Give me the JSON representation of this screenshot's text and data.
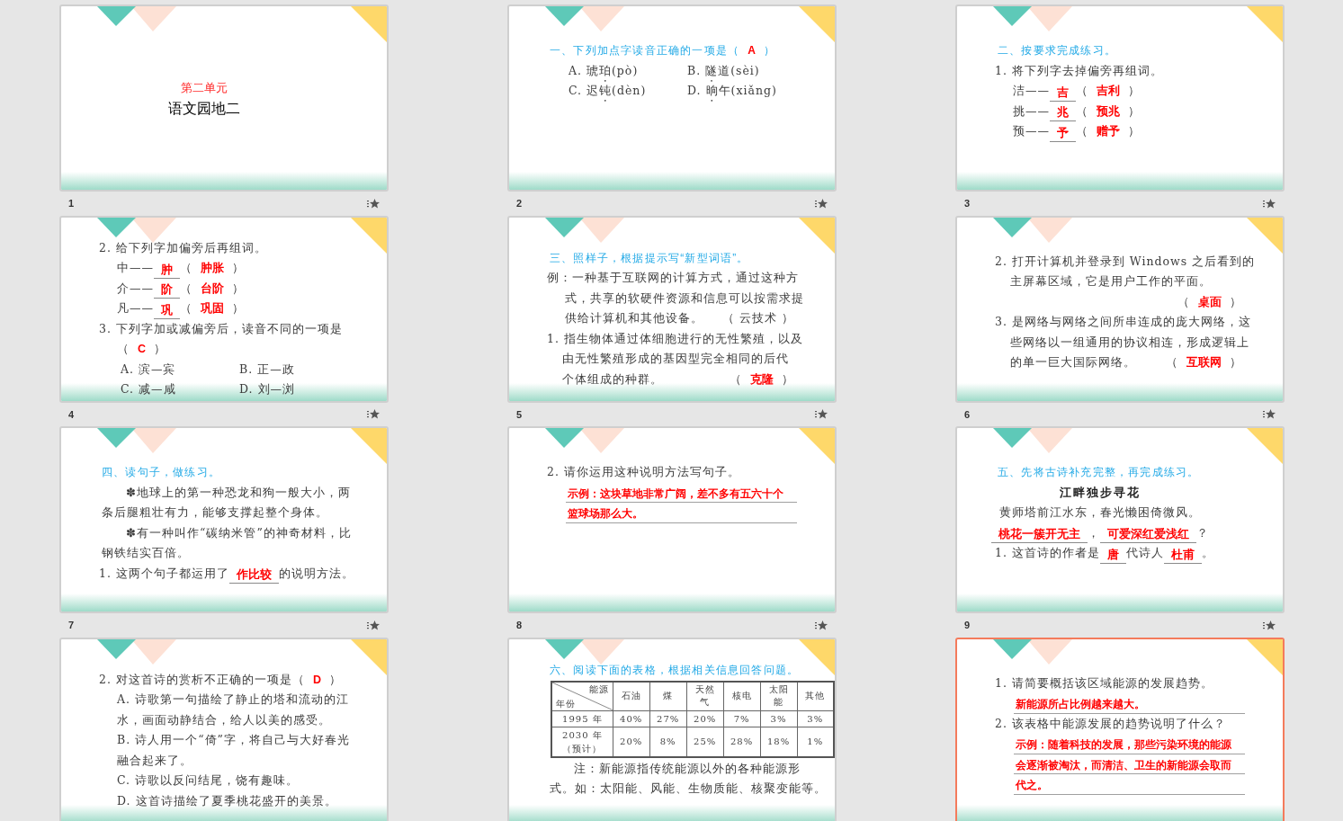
{
  "slides": [
    {
      "number": "1",
      "selected": false,
      "kind": "title",
      "lines": [
        {
          "kind": "kicker",
          "segs": [
            {
              "kind": "plain",
              "text": "第二单元"
            }
          ]
        },
        {
          "kind": "title",
          "segs": [
            {
              "kind": "plain",
              "text": "语文园地二"
            }
          ]
        }
      ]
    },
    {
      "number": "2",
      "selected": false,
      "kind": "content",
      "lines": [
        {
          "kind": "heading",
          "segs": [
            {
              "kind": "plain",
              "text": "一、下列加点字读音正确的一项是（"
            },
            {
              "kind": "answer",
              "text": "A"
            },
            {
              "kind": "plain",
              "text": "）"
            }
          ]
        },
        {
          "kind": "choices",
          "cols": [
            [
              {
                "kind": "dotted",
                "before": "A. 琥",
                "dotted": "珀",
                "after": "(pò)"
              }
            ],
            [
              {
                "kind": "dotted",
                "before": "B. ",
                "dotted": "隧",
                "after": "道(sèi)"
              }
            ]
          ]
        },
        {
          "kind": "choices",
          "cols": [
            [
              {
                "kind": "dotted",
                "before": "C. 迟",
                "dotted": "钝",
                "after": "(dèn)"
              }
            ],
            [
              {
                "kind": "dotted",
                "before": "D. ",
                "dotted": "晌",
                "after": "午(xiǎng)"
              }
            ]
          ]
        }
      ]
    },
    {
      "number": "3",
      "selected": false,
      "kind": "content",
      "lines": [
        {
          "kind": "heading",
          "segs": [
            {
              "kind": "plain",
              "text": "二、按要求完成练习。"
            }
          ]
        },
        {
          "kind": "item",
          "segs": [
            {
              "kind": "plain",
              "text": "1. 将下列字去掉偏旁再组词。"
            }
          ]
        },
        {
          "kind": "sub",
          "segs": [
            {
              "kind": "plain",
              "text": "洁——"
            },
            {
              "kind": "blank",
              "text": "吉"
            },
            {
              "kind": "plain",
              "text": "（"
            },
            {
              "kind": "answer",
              "text": "吉利"
            },
            {
              "kind": "plain",
              "text": "）"
            }
          ]
        },
        {
          "kind": "sub",
          "segs": [
            {
              "kind": "plain",
              "text": "挑——"
            },
            {
              "kind": "blank",
              "text": "兆"
            },
            {
              "kind": "plain",
              "text": "（"
            },
            {
              "kind": "answer",
              "text": "预兆"
            },
            {
              "kind": "plain",
              "text": "）"
            }
          ]
        },
        {
          "kind": "sub",
          "segs": [
            {
              "kind": "plain",
              "text": "预——"
            },
            {
              "kind": "blank",
              "text": "予"
            },
            {
              "kind": "plain",
              "text": "（"
            },
            {
              "kind": "answer",
              "text": "赠予"
            },
            {
              "kind": "plain",
              "text": "）"
            }
          ]
        }
      ]
    },
    {
      "number": "4",
      "selected": false,
      "kind": "content",
      "lines": [
        {
          "kind": "item",
          "segs": [
            {
              "kind": "plain",
              "text": "2. 给下列字加偏旁后再组词。"
            }
          ]
        },
        {
          "kind": "sub",
          "segs": [
            {
              "kind": "plain",
              "text": "中——"
            },
            {
              "kind": "blank",
              "text": "肿"
            },
            {
              "kind": "plain",
              "text": "（"
            },
            {
              "kind": "answer",
              "text": "肿胀"
            },
            {
              "kind": "plain",
              "text": "）"
            }
          ]
        },
        {
          "kind": "sub",
          "segs": [
            {
              "kind": "plain",
              "text": "介——"
            },
            {
              "kind": "blank",
              "text": "阶"
            },
            {
              "kind": "plain",
              "text": "（"
            },
            {
              "kind": "answer",
              "text": "台阶"
            },
            {
              "kind": "plain",
              "text": "）"
            }
          ]
        },
        {
          "kind": "sub",
          "segs": [
            {
              "kind": "plain",
              "text": "凡——"
            },
            {
              "kind": "blank",
              "text": "巩"
            },
            {
              "kind": "plain",
              "text": "（"
            },
            {
              "kind": "answer",
              "text": "巩固"
            },
            {
              "kind": "plain",
              "text": "）"
            }
          ]
        },
        {
          "kind": "item",
          "segs": [
            {
              "kind": "plain",
              "text": "3. 下列字加或减偏旁后，读音不同的一项是"
            }
          ]
        },
        {
          "kind": "sub",
          "segs": [
            {
              "kind": "plain",
              "text": "（"
            },
            {
              "kind": "answer",
              "text": "C"
            },
            {
              "kind": "plain",
              "text": "）"
            }
          ]
        },
        {
          "kind": "choices",
          "cols": [
            [
              {
                "kind": "plain",
                "text": "A. 滨—宾"
              }
            ],
            [
              {
                "kind": "plain",
                "text": "B. 正—政"
              }
            ]
          ]
        },
        {
          "kind": "choices",
          "cols": [
            [
              {
                "kind": "plain",
                "text": "C. 减—咸"
              }
            ],
            [
              {
                "kind": "plain",
                "text": "D. 刘—浏"
              }
            ]
          ]
        }
      ]
    },
    {
      "number": "5",
      "selected": false,
      "kind": "content",
      "lines": [
        {
          "kind": "heading",
          "segs": [
            {
              "kind": "plain",
              "text": "三、照样子，根据提示写“新型词语”。"
            }
          ]
        },
        {
          "kind": "item",
          "segs": [
            {
              "kind": "plain",
              "text": "例：一种基于互联网的计算方式，通过这种方"
            }
          ]
        },
        {
          "kind": "sub",
          "segs": [
            {
              "kind": "plain",
              "text": "式，共享的软硬件资源和信息可以按需求提"
            }
          ]
        },
        {
          "kind": "sub",
          "segs": [
            {
              "kind": "plain",
              "text": "供给计算机和其他设备。"
            },
            {
              "kind": "tail",
              "text": "（ 云技术 ）"
            }
          ]
        },
        {
          "kind": "item",
          "segs": [
            {
              "kind": "plain",
              "text": "1. 指生物体通过体细胞进行的无性繁殖，以及"
            }
          ]
        },
        {
          "kind": "cont",
          "segs": [
            {
              "kind": "plain",
              "text": "由无性繁殖形成的基因型完全相同的后代"
            }
          ]
        },
        {
          "kind": "cont",
          "segs": [
            {
              "kind": "plain",
              "text": "个体组成的种群。"
            },
            {
              "kind": "tail",
              "text": "（"
            },
            {
              "kind": "answer",
              "text": "克隆"
            },
            {
              "kind": "plain",
              "text": "）"
            }
          ]
        }
      ]
    },
    {
      "number": "6",
      "selected": false,
      "kind": "content",
      "lines": [
        {
          "kind": "item",
          "segs": [
            {
              "kind": "plain",
              "text": "2. 打开计算机并登录到 Windows 之后看到的"
            }
          ]
        },
        {
          "kind": "cont",
          "segs": [
            {
              "kind": "plain",
              "text": "主屏幕区域，它是用户工作的平面。"
            }
          ]
        },
        {
          "kind": "right",
          "segs": [
            {
              "kind": "plain",
              "text": "（"
            },
            {
              "kind": "answer",
              "text": "桌面"
            },
            {
              "kind": "plain",
              "text": "）"
            }
          ]
        },
        {
          "kind": "item",
          "segs": [
            {
              "kind": "plain",
              "text": "3. 是网络与网络之间所串连成的庞大网络，这"
            }
          ]
        },
        {
          "kind": "cont",
          "segs": [
            {
              "kind": "plain",
              "text": "些网络以一组通用的协议相连，形成逻辑上"
            }
          ]
        },
        {
          "kind": "cont",
          "segs": [
            {
              "kind": "plain",
              "text": "的单一巨大国际网络。"
            },
            {
              "kind": "tail",
              "text": "（"
            },
            {
              "kind": "answer",
              "text": "互联网"
            },
            {
              "kind": "plain",
              "text": "）"
            }
          ]
        }
      ]
    },
    {
      "number": "7",
      "selected": false,
      "kind": "content",
      "lines": [
        {
          "kind": "heading",
          "segs": [
            {
              "kind": "plain",
              "text": "四、读句子，做练习。"
            }
          ]
        },
        {
          "kind": "indent",
          "segs": [
            {
              "kind": "plain",
              "text": "✽地球上的第一种恐龙和狗一般大小，两"
            }
          ]
        },
        {
          "kind": "flush",
          "segs": [
            {
              "kind": "plain",
              "text": "条后腿粗壮有力，能够支撑起整个身体。"
            }
          ]
        },
        {
          "kind": "indent",
          "segs": [
            {
              "kind": "plain",
              "text": "✽有一种叫作“碳纳米管”的神奇材料，比"
            }
          ]
        },
        {
          "kind": "flush",
          "segs": [
            {
              "kind": "plain",
              "text": "钢铁结实百倍。"
            }
          ]
        },
        {
          "kind": "item",
          "segs": [
            {
              "kind": "plain",
              "text": "1. 这两个句子都运用了"
            },
            {
              "kind": "blank",
              "text": "作比较"
            },
            {
              "kind": "plain",
              "text": "的说明方法。"
            }
          ]
        }
      ]
    },
    {
      "number": "8",
      "selected": false,
      "kind": "content",
      "lines": [
        {
          "kind": "item",
          "segs": [
            {
              "kind": "plain",
              "text": "2. 请你运用这种说明方法写句子。"
            }
          ]
        },
        {
          "kind": "fill",
          "segs": [
            {
              "kind": "plain",
              "text": "示例：这块草地非常广阔，差不多有五六十个"
            }
          ]
        },
        {
          "kind": "fill",
          "segs": [
            {
              "kind": "plain",
              "text": "篮球场那么大。"
            }
          ]
        }
      ]
    },
    {
      "number": "9",
      "selected": false,
      "kind": "content",
      "lines": [
        {
          "kind": "heading",
          "segs": [
            {
              "kind": "plain",
              "text": "五、先将古诗补充完整，再完成练习。"
            }
          ]
        },
        {
          "kind": "poem-title",
          "segs": [
            {
              "kind": "plain",
              "text": "江畔独步寻花"
            }
          ]
        },
        {
          "kind": "center",
          "segs": [
            {
              "kind": "plain",
              "text": "黄师塔前江水东，春光懒困倚微风。"
            }
          ]
        },
        {
          "kind": "center",
          "segs": [
            {
              "kind": "blank",
              "text": "桃花一簇开无主"
            },
            {
              "kind": "plain",
              "text": "，"
            },
            {
              "kind": "blank",
              "text": "可爱深红爱浅红"
            },
            {
              "kind": "plain",
              "text": "？"
            }
          ]
        },
        {
          "kind": "item",
          "segs": [
            {
              "kind": "plain",
              "text": "1. 这首诗的作者是"
            },
            {
              "kind": "blank",
              "text": "唐"
            },
            {
              "kind": "plain",
              "text": "代诗人"
            },
            {
              "kind": "blank",
              "text": "杜甫"
            },
            {
              "kind": "plain",
              "text": "。"
            }
          ]
        }
      ]
    },
    {
      "selected": false,
      "kind": "content",
      "lines": [
        {
          "kind": "item",
          "segs": [
            {
              "kind": "plain",
              "text": "2. 对这首诗的赏析不正确的一项是（"
            },
            {
              "kind": "answer",
              "text": "D"
            },
            {
              "kind": "plain",
              "text": "）"
            }
          ]
        },
        {
          "kind": "sub",
          "segs": [
            {
              "kind": "plain",
              "text": "A. 诗歌第一句描绘了静止的塔和流动的江"
            }
          ]
        },
        {
          "kind": "sub",
          "segs": [
            {
              "kind": "plain",
              "text": "水，画面动静结合，给人以美的感受。"
            }
          ]
        },
        {
          "kind": "sub",
          "segs": [
            {
              "kind": "plain",
              "text": "B. 诗人用一个“倚”字，将自己与大好春光"
            }
          ]
        },
        {
          "kind": "sub",
          "segs": [
            {
              "kind": "plain",
              "text": "融合起来了。"
            }
          ]
        },
        {
          "kind": "sub",
          "segs": [
            {
              "kind": "plain",
              "text": "C. 诗歌以反问结尾，饶有趣味。"
            }
          ]
        },
        {
          "kind": "sub",
          "segs": [
            {
              "kind": "plain",
              "text": "D. 这首诗描绘了夏季桃花盛开的美景。"
            }
          ]
        }
      ]
    },
    {
      "selected": false,
      "kind": "content",
      "lines": [
        {
          "kind": "heading",
          "segs": [
            {
              "kind": "plain",
              "text": "六、阅读下面的表格，根据相关信息回答问题。"
            }
          ]
        },
        {
          "kind": "table",
          "corner": {
            "top": "能源",
            "bottom": "年份"
          },
          "columns": [
            "石油",
            "煤",
            "天然气",
            "核电",
            "太阳能",
            "其他"
          ],
          "rows": [
            {
              "label": [
                "1995 年"
              ],
              "cells": [
                "40%",
                "27%",
                "20%",
                "7%",
                "3%",
                "3%"
              ]
            },
            {
              "label": [
                "2030 年",
                "（预计）"
              ],
              "cells": [
                "20%",
                "8%",
                "25%",
                "28%",
                "18%",
                "1%"
              ]
            }
          ]
        },
        {
          "kind": "indent",
          "segs": [
            {
              "kind": "plain",
              "text": "注：新能源指传统能源以外的各种能源形"
            }
          ]
        },
        {
          "kind": "flush",
          "segs": [
            {
              "kind": "plain",
              "text": "式。如：太阳能、风能、生物质能、核聚变能等。"
            }
          ]
        }
      ]
    },
    {
      "selected": true,
      "kind": "content",
      "lines": [
        {
          "kind": "item",
          "segs": [
            {
              "kind": "plain",
              "text": "1. 请简要概括该区域能源的发展趋势。"
            }
          ]
        },
        {
          "kind": "fill",
          "segs": [
            {
              "kind": "plain",
              "text": "新能源所占比例越来越大。"
            }
          ]
        },
        {
          "kind": "item",
          "segs": [
            {
              "kind": "plain",
              "text": "2. 该表格中能源发展的趋势说明了什么？"
            }
          ]
        },
        {
          "kind": "fill",
          "segs": [
            {
              "kind": "plain",
              "text": "示例：随着科技的发展，那些污染环境的能源"
            }
          ]
        },
        {
          "kind": "fill",
          "segs": [
            {
              "kind": "plain",
              "text": "会逐渐被淘汰，而清洁、卫生的新能源会取而"
            }
          ]
        },
        {
          "kind": "fill",
          "segs": [
            {
              "kind": "plain",
              "text": "代之。"
            }
          ]
        }
      ]
    }
  ]
}
